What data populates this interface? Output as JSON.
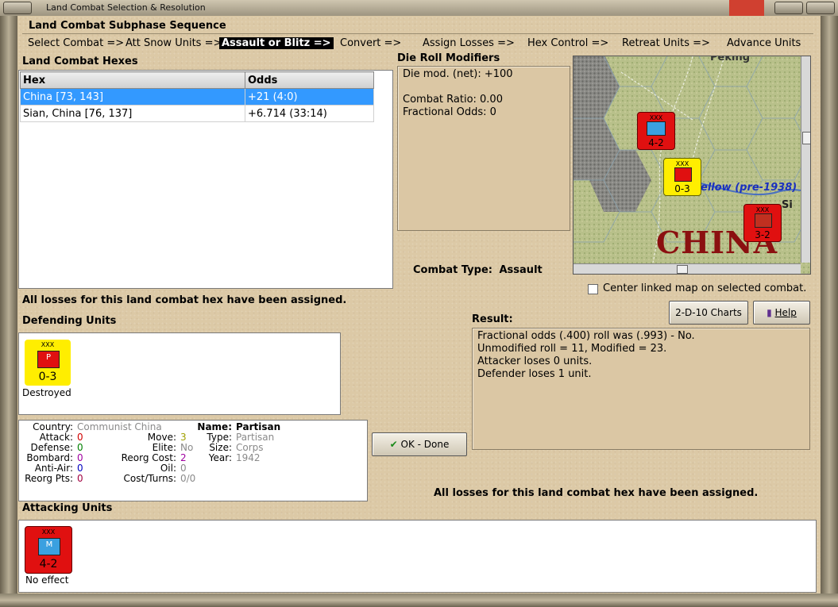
{
  "window": {
    "title": "Land Combat Selection & Resolution"
  },
  "phase": {
    "heading": "Land Combat Subphase Sequence",
    "steps": [
      {
        "label": "Select Combat =>"
      },
      {
        "label": "Att Snow Units =>"
      },
      {
        "label": "Assault or Blitz =>"
      },
      {
        "label": "Convert =>"
      },
      {
        "label": "Assign Losses =>"
      },
      {
        "label": "Hex Control =>"
      },
      {
        "label": "Retreat Units =>"
      },
      {
        "label": "Advance Units"
      }
    ],
    "active_step": "Assault or Blitz =>"
  },
  "hexes": {
    "heading": "Land Combat Hexes",
    "columns": [
      "Hex",
      "Odds"
    ],
    "rows": [
      {
        "hex": "China [73, 143]",
        "odds": "+21 (4:0)",
        "selected": true
      },
      {
        "hex": "Sian, China [76, 137]",
        "odds": "+6.714 (33:14)",
        "selected": false
      }
    ]
  },
  "modifiers": {
    "heading": "Die Roll Modifiers",
    "lines": [
      "Die mod. (net): +100",
      "",
      "Combat Ratio: 0.00",
      "Fractional Odds: 0"
    ]
  },
  "combat_type": {
    "label": "Combat Type:",
    "value": "Assault"
  },
  "map": {
    "region_label": "CHINA",
    "river_label": "ellow (pre-1938)",
    "partial_top": "Peking",
    "partial_city": "Si",
    "center_checkbox": {
      "label": "Center linked map on selected combat.",
      "checked": false
    },
    "units": [
      {
        "size": "XXX",
        "strength": "4-2",
        "color": "#e01010",
        "type": "M"
      },
      {
        "size": "XXX",
        "strength": "0-3",
        "color": "#ffee00",
        "type": "P"
      },
      {
        "size": "XXX",
        "strength": "3-2",
        "color": "#e01010",
        "type": "W"
      }
    ]
  },
  "status_msg": "All losses for this land combat hex have been assigned.",
  "buttons": {
    "charts": "2-D-10 Charts",
    "help": "Help",
    "ok": "OK - Done"
  },
  "result": {
    "heading": "Result:",
    "lines": [
      "Fractional odds (.400) roll was (.993)  - No.",
      "Unmodified roll = 11, Modified = 23.",
      "Attacker loses 0 units.",
      "Defender loses 1 unit."
    ]
  },
  "defending": {
    "heading": "Defending Units",
    "unit": {
      "size": "XXX",
      "type": "P",
      "strength": "0-3",
      "status": "Destroyed",
      "color": "#ffee00"
    }
  },
  "details": {
    "country_label": "Country:",
    "country": "Communist China",
    "attack_label": "Attack:",
    "attack": "0",
    "defense_label": "Defense:",
    "defense": "0",
    "bombard_label": "Bombard:",
    "bombard": "0",
    "antiair_label": "Anti-Air:",
    "antiair": "0",
    "reorgpts_label": "Reorg Pts:",
    "reorgpts": "0",
    "move_label": "Move:",
    "move": "3",
    "elite_label": "Elite:",
    "elite": "No",
    "reorgcost_label": "Reorg Cost:",
    "reorgcost": "2",
    "oil_label": "Oil:",
    "oil": "0",
    "costturns_label": "Cost/Turns:",
    "costturns": "0/0",
    "name_label": "Name:",
    "name": "Partisan",
    "type_label": "Type:",
    "type": "Partisan",
    "size_label": "Size:",
    "size": "Corps",
    "year_label": "Year:",
    "year": "1942"
  },
  "bottom_msg": "All losses for this land combat hex have been assigned.",
  "attacking": {
    "heading": "Attacking Units",
    "unit": {
      "size": "XXX",
      "type": "M",
      "strength": "4-2",
      "status": "No effect",
      "color": "#e01010"
    }
  }
}
